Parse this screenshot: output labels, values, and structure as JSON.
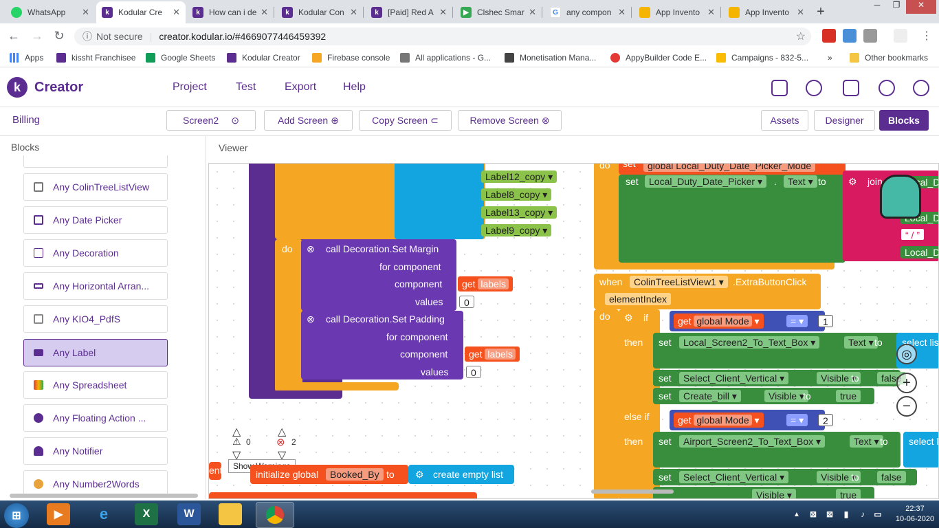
{
  "browser": {
    "tabs": [
      {
        "title": "WhatsApp",
        "color": "#25d366"
      },
      {
        "title": "Kodular Cre",
        "color": "#5c2d91"
      },
      {
        "title": "How can i de",
        "color": "#5c2d91"
      },
      {
        "title": "Kodular Con",
        "color": "#5c2d91"
      },
      {
        "title": "[Paid] Red A",
        "color": "#5c2d91"
      },
      {
        "title": "Clshec Smar",
        "color": "#34a853"
      },
      {
        "title": "any compon",
        "color": "#4285f4"
      },
      {
        "title": "App Invento",
        "color": "#f4b400"
      },
      {
        "title": "App Invento",
        "color": "#f4b400"
      }
    ],
    "not_secure": "Not secure",
    "url": "creator.kodular.io/#4669077446459392",
    "bookmarks": [
      "Apps",
      "kissht Franchisee",
      "Google Sheets",
      "Kodular Creator",
      "Firebase console",
      "All applications - G...",
      "Monetisation Mana...",
      "AppyBuilder Code E...",
      "Campaigns - 832-5...",
      "Other bookmarks"
    ],
    "bookmark_more": "»"
  },
  "app": {
    "logo_text": "Creator",
    "menu": [
      "Project",
      "Test",
      "Export",
      "Help"
    ],
    "project_name": "Billing",
    "screen_select": "Screen2",
    "add_screen": "Add Screen",
    "copy_screen": "Copy Screen",
    "remove_screen": "Remove Screen",
    "assets": "Assets",
    "designer": "Designer",
    "blocks": "Blocks"
  },
  "sidebar": {
    "title": "Blocks",
    "items": [
      {
        "label": "Any ColinTreeListView",
        "color": "#777"
      },
      {
        "label": "Any Date Picker",
        "color": "#5c2d91"
      },
      {
        "label": "Any Decoration",
        "color": "#5c2d91"
      },
      {
        "label": "Any Horizontal Arran...",
        "color": "#5c2d91"
      },
      {
        "label": "Any KIO4_PdfS",
        "color": "#888"
      },
      {
        "label": "Any Label",
        "color": "#5c2d91"
      },
      {
        "label": "Any Spreadsheet",
        "color": "#e8a33d"
      },
      {
        "label": "Any Floating Action ...",
        "color": "#5c2d91"
      },
      {
        "label": "Any Notifier",
        "color": "#5c2d91"
      },
      {
        "label": "Any Number2Words",
        "color": "#e8a33d"
      }
    ]
  },
  "viewer": {
    "title": "Viewer",
    "warnings_count": "0",
    "errors_count": "2",
    "show_warnings": "Show Warnings"
  },
  "blocks": {
    "labels_copy": [
      "Label12_copy",
      "Label8_copy",
      "Label13_copy",
      "Label9_copy"
    ],
    "do": "do",
    "set_margin": "call Decoration.Set Margin",
    "set_padding": "call Decoration.Set Padding",
    "for_component": "for component",
    "component": "component",
    "values": "values",
    "get": "get",
    "labels": "labels",
    "zero": "0",
    "init_global": "initialize global",
    "booked_by": "Booked_By",
    "to": "to",
    "create_empty_list": "create empty list",
    "ent": "ent",
    "set": "set",
    "global_local_duty": "global Local_Duty_Date_Picker_Mode",
    "local_duty_picker": "Local_Duty_Date_Picker",
    "text": "Text",
    "join": "join",
    "local_d": "Local_D",
    "slash": "“ / ”",
    "when": "when",
    "colin_tree": "ColinTreeListView1",
    "extra_click": ".ExtraButtonClick",
    "element_index": "elementIndex",
    "if": "if",
    "then": "then",
    "else_if": "else if",
    "global_mode": "global Mode",
    "eq": "=",
    "one": "1",
    "two": "2",
    "local_screen2": "Local_Screen2_To_Text_Box",
    "select_list": "select list",
    "select_client": "Select_Client_Vertical",
    "visible": "Visible",
    "false": "false",
    "true": "true",
    "create_bill": "Create_bill",
    "airport_screen2": "Airport_Screen2_To_Text_Box",
    "select_l": "select l"
  },
  "taskbar": {
    "time": "22:37",
    "date": "10-06-2020"
  }
}
